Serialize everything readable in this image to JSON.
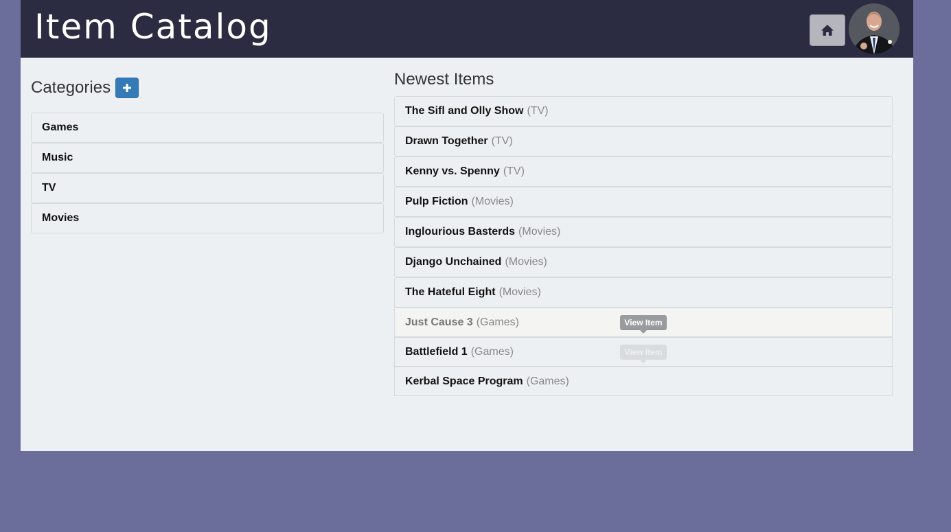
{
  "header": {
    "title": "Item Catalog",
    "home_icon": "home-icon",
    "avatar": "user-avatar"
  },
  "categories": {
    "heading": "Categories",
    "add_icon": "plus-icon",
    "items": [
      {
        "label": "Games"
      },
      {
        "label": "Music"
      },
      {
        "label": "TV"
      },
      {
        "label": "Movies"
      }
    ]
  },
  "newest": {
    "heading": "Newest Items",
    "items": [
      {
        "name": "The Sifl and Olly Show",
        "category": "(TV)"
      },
      {
        "name": "Drawn Together",
        "category": "(TV)"
      },
      {
        "name": "Kenny vs. Spenny",
        "category": "(TV)"
      },
      {
        "name": "Pulp Fiction",
        "category": "(Movies)"
      },
      {
        "name": "Inglourious Basterds",
        "category": "(Movies)"
      },
      {
        "name": "Django Unchained",
        "category": "(Movies)"
      },
      {
        "name": "The Hateful Eight",
        "category": "(Movies)"
      },
      {
        "name": "Just Cause 3",
        "category": "(Games)",
        "tooltip": "View Item"
      },
      {
        "name": "Battlefield 1",
        "category": "(Games)",
        "tooltip": "View Item"
      },
      {
        "name": "Kerbal Space Program",
        "category": "(Games)"
      }
    ]
  },
  "colors": {
    "background": "#6b6d9a",
    "header": "#2b2c42",
    "accent": "#337ab7"
  }
}
